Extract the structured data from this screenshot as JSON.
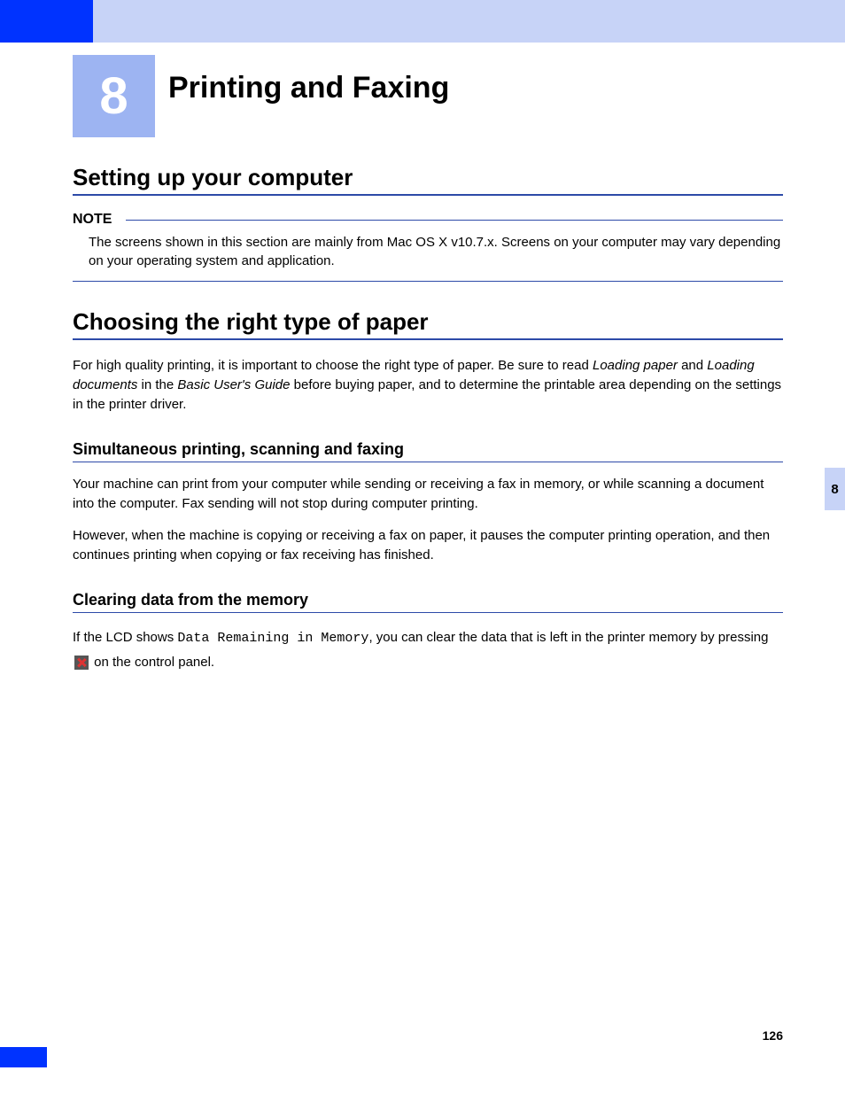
{
  "chapter": {
    "number": "8",
    "title": "Printing and Faxing"
  },
  "section1": {
    "heading": "Setting up your computer",
    "note_label": "NOTE",
    "note_text": "The screens shown in this section are mainly from Mac OS X v10.7.x. Screens on your computer may vary depending on your operating system and application."
  },
  "section2": {
    "heading": "Choosing the right type of paper",
    "para_pre": "For high quality printing, it is important to choose the right type of paper. Be sure to read ",
    "para_it1": "Loading paper",
    "para_mid1": " and ",
    "para_it2": "Loading documents",
    "para_mid2": " in the ",
    "para_it3": "Basic User's Guide",
    "para_post": " before buying paper, and to determine the printable area depending on the settings in the printer driver."
  },
  "section3": {
    "heading": "Simultaneous printing, scanning and faxing",
    "para1": "Your machine can print from your computer while sending or receiving a fax in memory, or while scanning a document into the computer. Fax sending will not stop during computer printing.",
    "para2": "However, when the machine is copying or receiving a fax on paper, it pauses the computer printing operation, and then continues printing when copying or fax receiving has finished."
  },
  "section4": {
    "heading": "Clearing data from the memory",
    "para_pre": "If the LCD shows ",
    "para_mono": "Data Remaining in Memory",
    "para_mid": ", you can clear the data that is left in the printer memory by pressing ",
    "para_post": " on the control panel."
  },
  "sidetab": "8",
  "page_number": "126"
}
